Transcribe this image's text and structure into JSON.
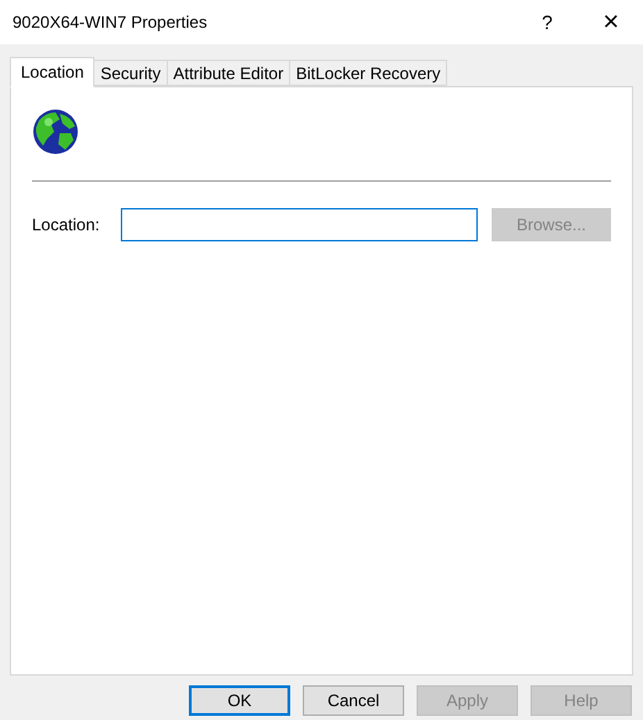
{
  "window": {
    "title": "9020X64-WIN7 Properties",
    "help": "?",
    "close": "×"
  },
  "tabs": [
    {
      "label": "Location",
      "selected": true
    },
    {
      "label": "Security",
      "selected": false
    },
    {
      "label": "Attribute Editor",
      "selected": false
    },
    {
      "label": "BitLocker Recovery",
      "selected": false
    }
  ],
  "location": {
    "label": "Location:",
    "focused": true,
    "browse": {
      "label": "Browse...",
      "disabled": true
    }
  },
  "buttons": [
    {
      "label": "OK",
      "default": true,
      "disabled": false
    },
    {
      "label": "Cancel",
      "default": false,
      "disabled": false
    },
    {
      "label": "Apply",
      "default": false,
      "disabled": true
    },
    {
      "label": "Help",
      "default": false,
      "disabled": true
    }
  ]
}
